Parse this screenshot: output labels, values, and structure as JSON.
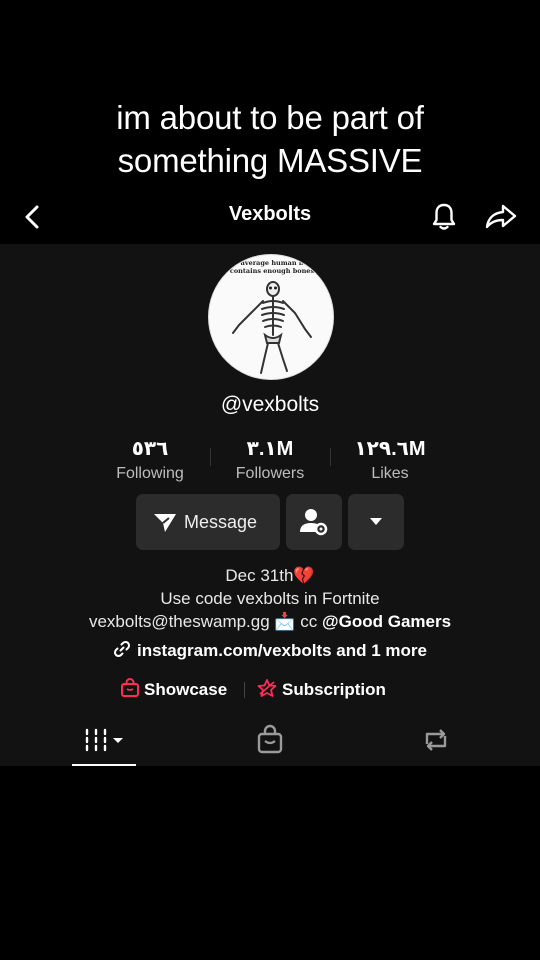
{
  "caption": {
    "line1": "im about to be part of",
    "line2": "something MASSIVE"
  },
  "topbar": {
    "title": "Vexbolts",
    "icons": [
      "back-arrow-icon",
      "bell-icon",
      "share-icon"
    ]
  },
  "avatar": {
    "text_line1": "average human b",
    "text_line2": "contains enough bones",
    "image": "skeleton"
  },
  "profile": {
    "handle": "@vexbolts"
  },
  "stats": [
    {
      "value": "٥٣٦",
      "label": "Following"
    },
    {
      "value": "٣.١M",
      "label": "Followers"
    },
    {
      "value": "١٢٩.٦M",
      "label": "Likes"
    }
  ],
  "actions": {
    "message_label": "Message",
    "icons": [
      "send-icon",
      "person-gear-icon",
      "caret-down-icon"
    ]
  },
  "bio": {
    "line1": "Dec 31th💔",
    "line2": "Use code vexbolts in Fortnite",
    "line3_text": "vexbolts@theswamp.gg 📩 cc",
    "line3_tag": "@Good Gamers",
    "link_text": "instagram.com/vexbolts and 1 more"
  },
  "shop": {
    "showcase_label": "Showcase",
    "subscription_label": "Subscription",
    "accent": "#fe2c55"
  },
  "tabs": [
    "grid-icon",
    "shopping-bag-icon",
    "repost-icon"
  ]
}
